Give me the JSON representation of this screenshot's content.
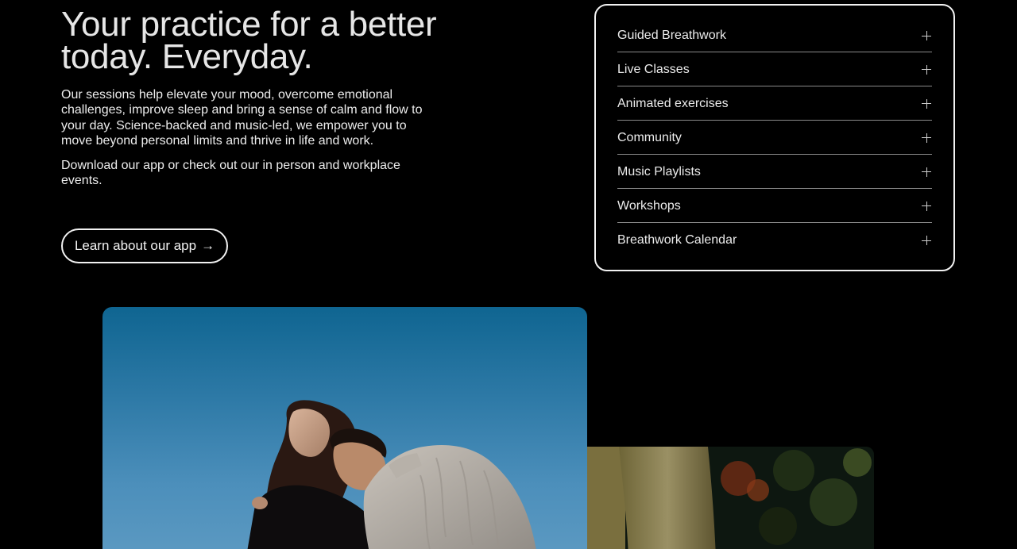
{
  "hero": {
    "title_line1": "Your practice for a better",
    "title_line2": "today. Everyday.",
    "body": "Our sessions help elevate your mood, overcome emotional challenges, improve sleep and bring a sense of calm and flow to your day. Science-backed and music-led, we empower you to move beyond personal limits and thrive in life and work.",
    "body2": "Download our app or check out our in person and workplace events.",
    "cta_label": "Learn about our app",
    "cta_arrow": "→"
  },
  "accordion": {
    "items": [
      {
        "label": "Guided Breathwork",
        "icon": "plus-icon"
      },
      {
        "label": "Live Classes",
        "icon": "plus-icon"
      },
      {
        "label": "Animated exercises",
        "icon": "plus-icon"
      },
      {
        "label": "Community",
        "icon": "plus-icon"
      },
      {
        "label": "Music Playlists",
        "icon": "plus-icon"
      },
      {
        "label": "Workshops",
        "icon": "plus-icon"
      },
      {
        "label": "Breathwork Calendar",
        "icon": "plus-icon"
      }
    ]
  },
  "colors": {
    "background": "#000000",
    "text": "#ececec",
    "border": "#f2f2f2",
    "divider": "#8a8a8a",
    "sky": "#2d79a6"
  }
}
